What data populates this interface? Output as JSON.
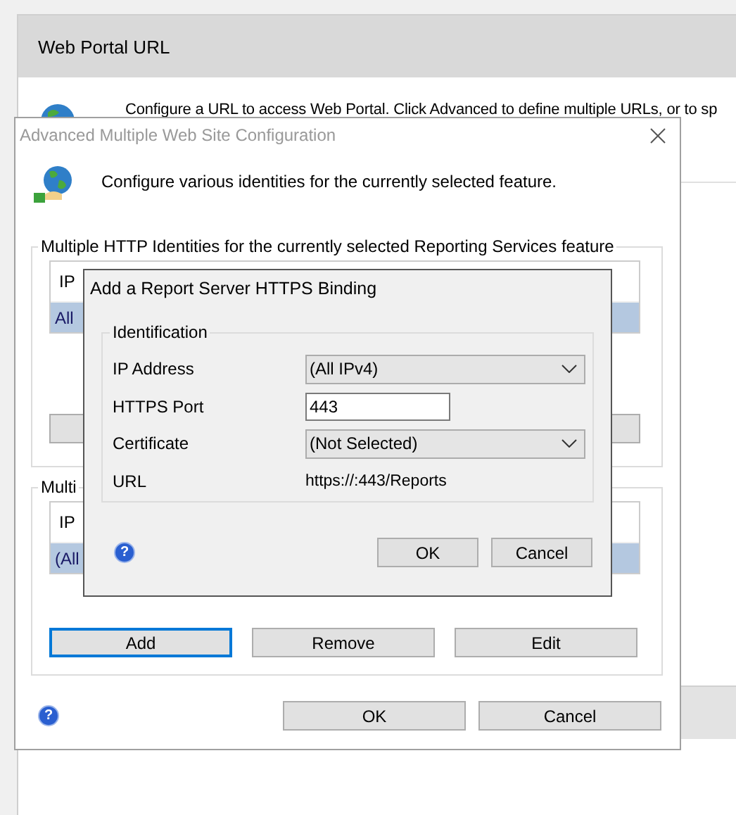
{
  "background_window": {
    "title": "Web Portal URL",
    "description": "Configure a URL to access Web Portal.  Click Advanced to define multiple URLs, or to sp"
  },
  "advanced_dialog": {
    "title": "Advanced Multiple Web Site Configuration",
    "intro": "Configure various identities for the currently selected feature.",
    "groups": [
      {
        "legend": "Multiple HTTP Identities for the currently selected Reporting Services feature",
        "header": "IP",
        "rows": [
          {
            "cell": "All",
            "selected": true
          }
        ]
      },
      {
        "legend": "Multi",
        "header": "IP",
        "rows": [
          {
            "cell": "(All",
            "selected": true
          }
        ],
        "buttons": [
          {
            "label": "Add",
            "focused": true
          },
          {
            "label": "Remove",
            "focused": false
          },
          {
            "label": "Edit",
            "focused": false
          }
        ]
      }
    ],
    "help": "?",
    "buttons": [
      "OK",
      "Cancel"
    ]
  },
  "https_dialog": {
    "title": "Add a Report Server HTTPS Binding",
    "group": "Identification",
    "fields": [
      {
        "label": "IP Address",
        "kind": "combo",
        "value": "(All IPv4)"
      },
      {
        "label": "HTTPS Port",
        "kind": "input",
        "value": "443"
      },
      {
        "label": "Certificate",
        "kind": "combo",
        "value": "(Not Selected)"
      },
      {
        "label": "URL",
        "kind": "text",
        "value": "https://:443/Reports"
      }
    ],
    "help": "?",
    "buttons": [
      "OK",
      "Cancel"
    ]
  }
}
